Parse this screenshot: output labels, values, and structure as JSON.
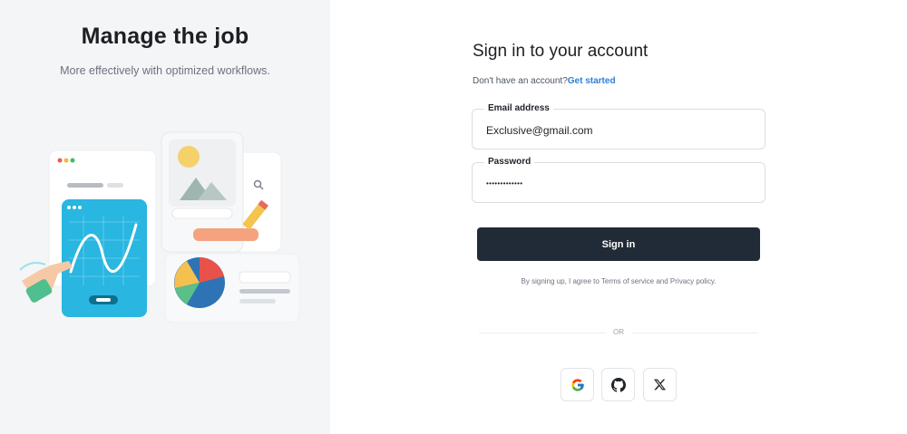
{
  "left": {
    "title": "Manage the job",
    "subtitle": "More effectively with optimized workflows."
  },
  "form": {
    "title": "Sign in to your account",
    "no_account_text": "Don't have an account?",
    "get_started_link": "Get started",
    "email_label": "Email address",
    "email_value": "Exclusive@gmail.com",
    "password_label": "Password",
    "password_value": "•••••••••••••",
    "signin_label": "Sign in",
    "terms_prefix": "By signing up, I agree to ",
    "terms_link": "Terms of service",
    "terms_and": " and ",
    "privacy_link": "Privacy policy",
    "terms_suffix": ".",
    "or_label": "OR"
  },
  "social": [
    {
      "name": "google-icon"
    },
    {
      "name": "github-icon"
    },
    {
      "name": "x-icon"
    }
  ],
  "colors": {
    "left_panel_bg": "#f4f5f6",
    "primary_button": "#212a37",
    "link": "#2f7fd8",
    "accent_teal": "#29b6e0"
  }
}
